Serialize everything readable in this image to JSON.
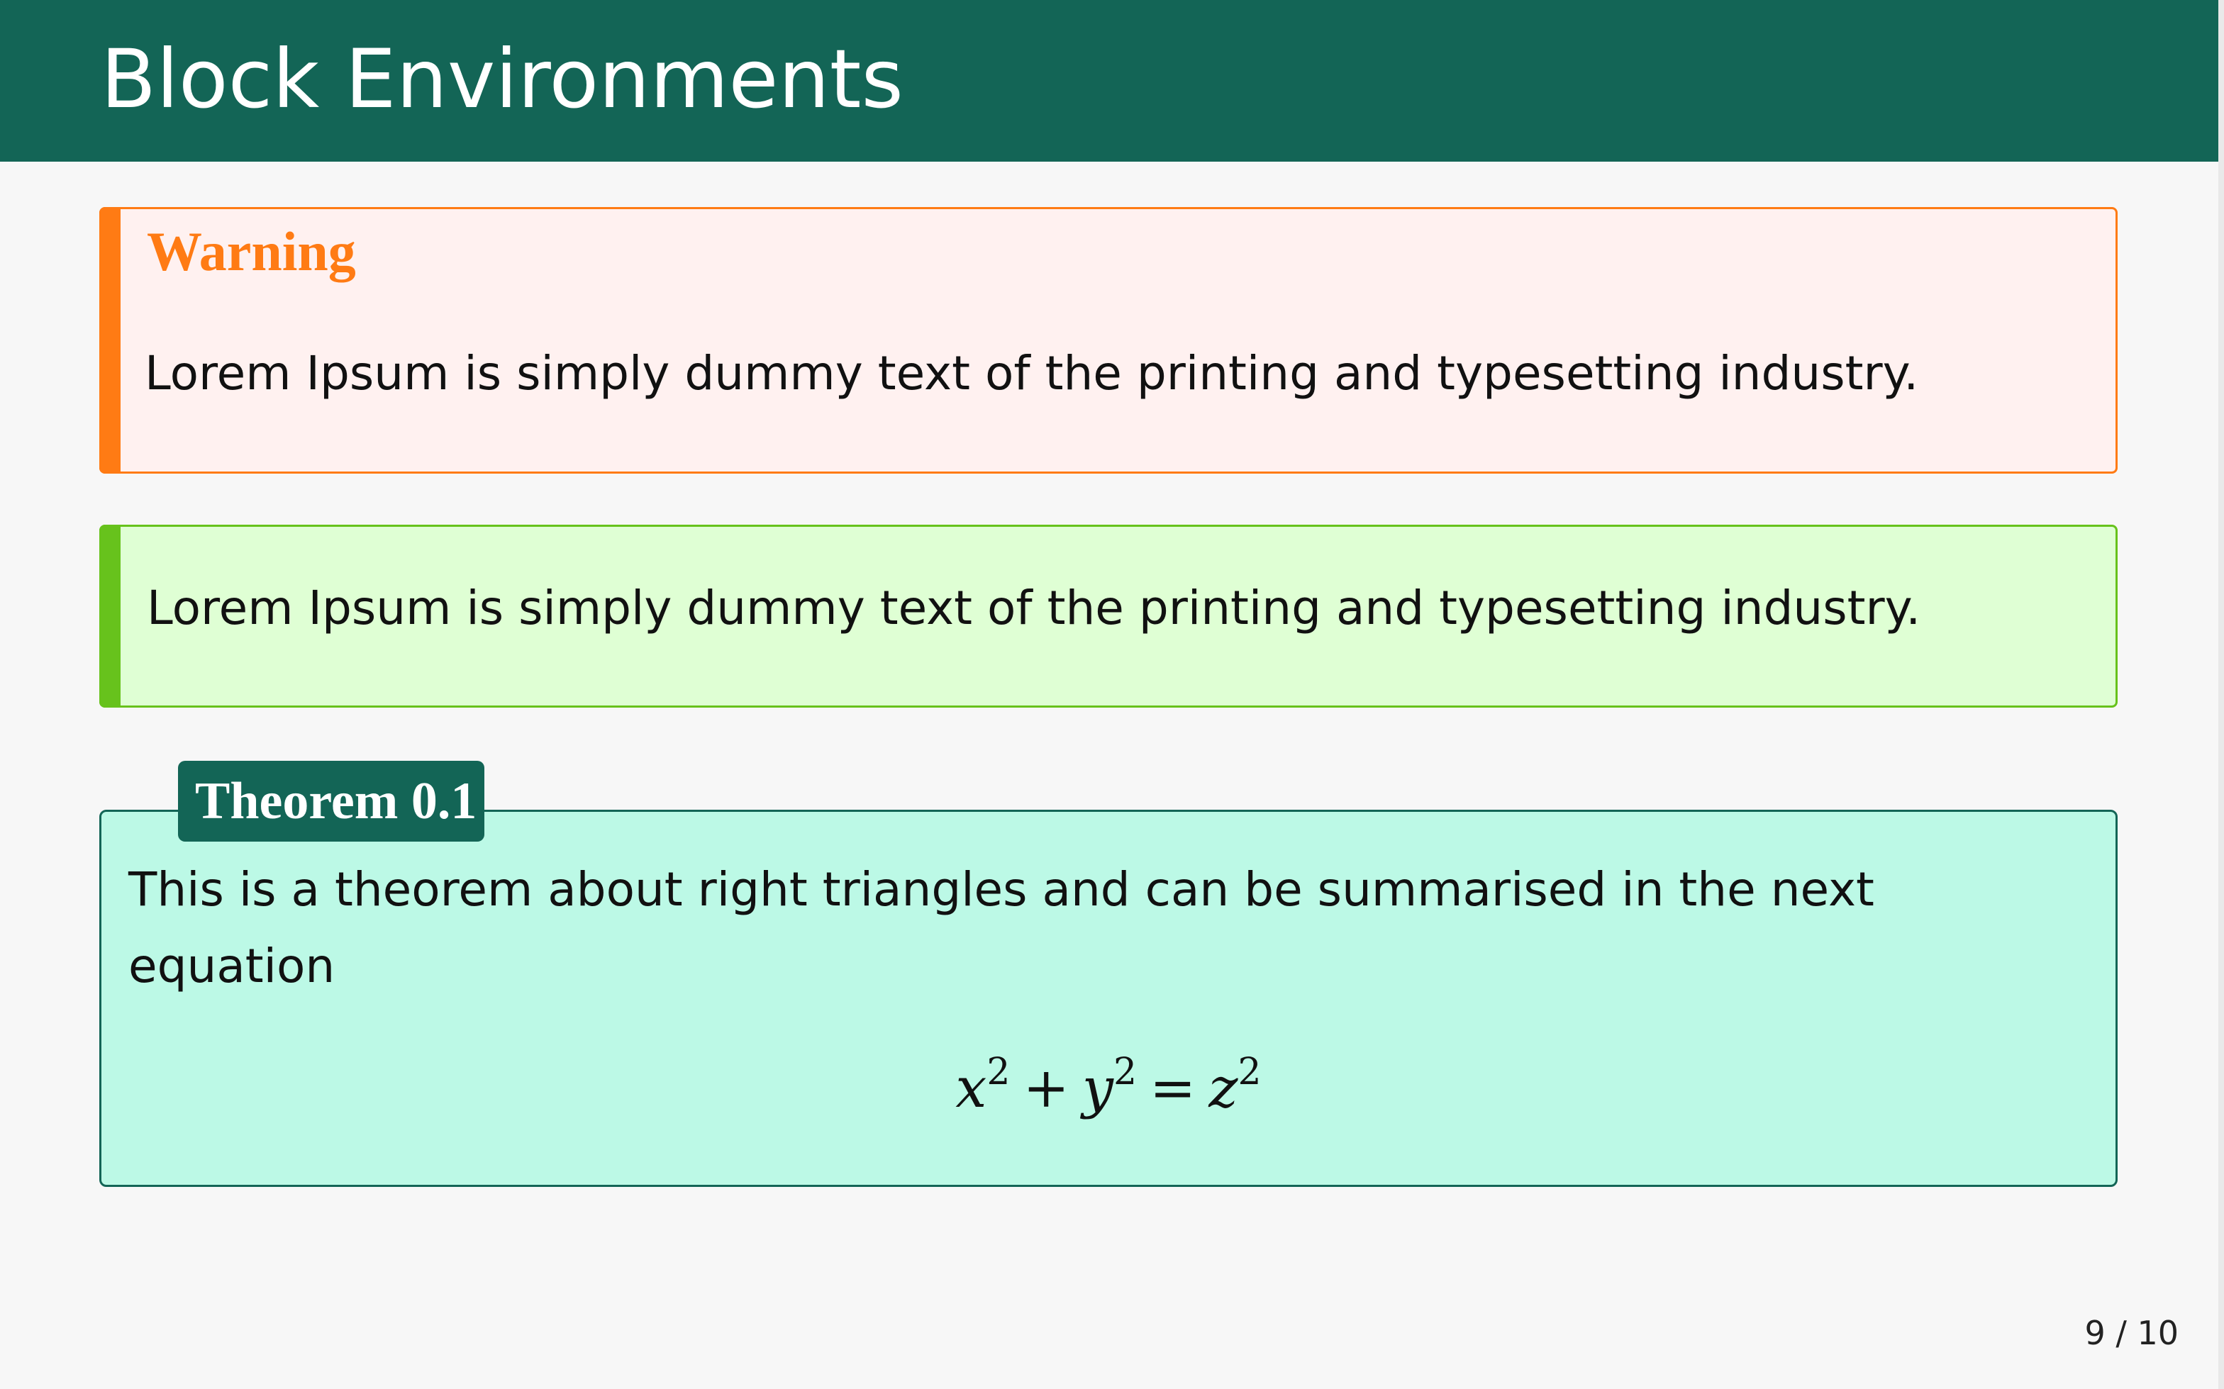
{
  "slide": {
    "title": "Block Environments",
    "page_current": 9,
    "page_total": 10,
    "page_label": "9 / 10"
  },
  "blocks": {
    "warning": {
      "title": "Warning",
      "text": "Lorem Ipsum is simply dummy text of the printing and typesetting industry.",
      "accent_color": "#ff7b14",
      "background_color": "#fff1f0"
    },
    "success": {
      "text": "Lorem Ipsum is simply dummy text of the printing and typesetting industry.",
      "accent_color": "#67c21c",
      "background_color": "#dfffd4"
    },
    "theorem": {
      "label": "Theorem 0.1",
      "text": "This is a theorem about right triangles and can be summarised in the next equation",
      "equation": {
        "terms": [
          "x",
          "y",
          "z"
        ],
        "exponent": "2",
        "plus": "+",
        "equals": "="
      },
      "accent_color": "#136556",
      "background_color": "#bcf9e6"
    }
  },
  "theme": {
    "header_color": "#136556",
    "page_background": "#f7f7f7"
  }
}
